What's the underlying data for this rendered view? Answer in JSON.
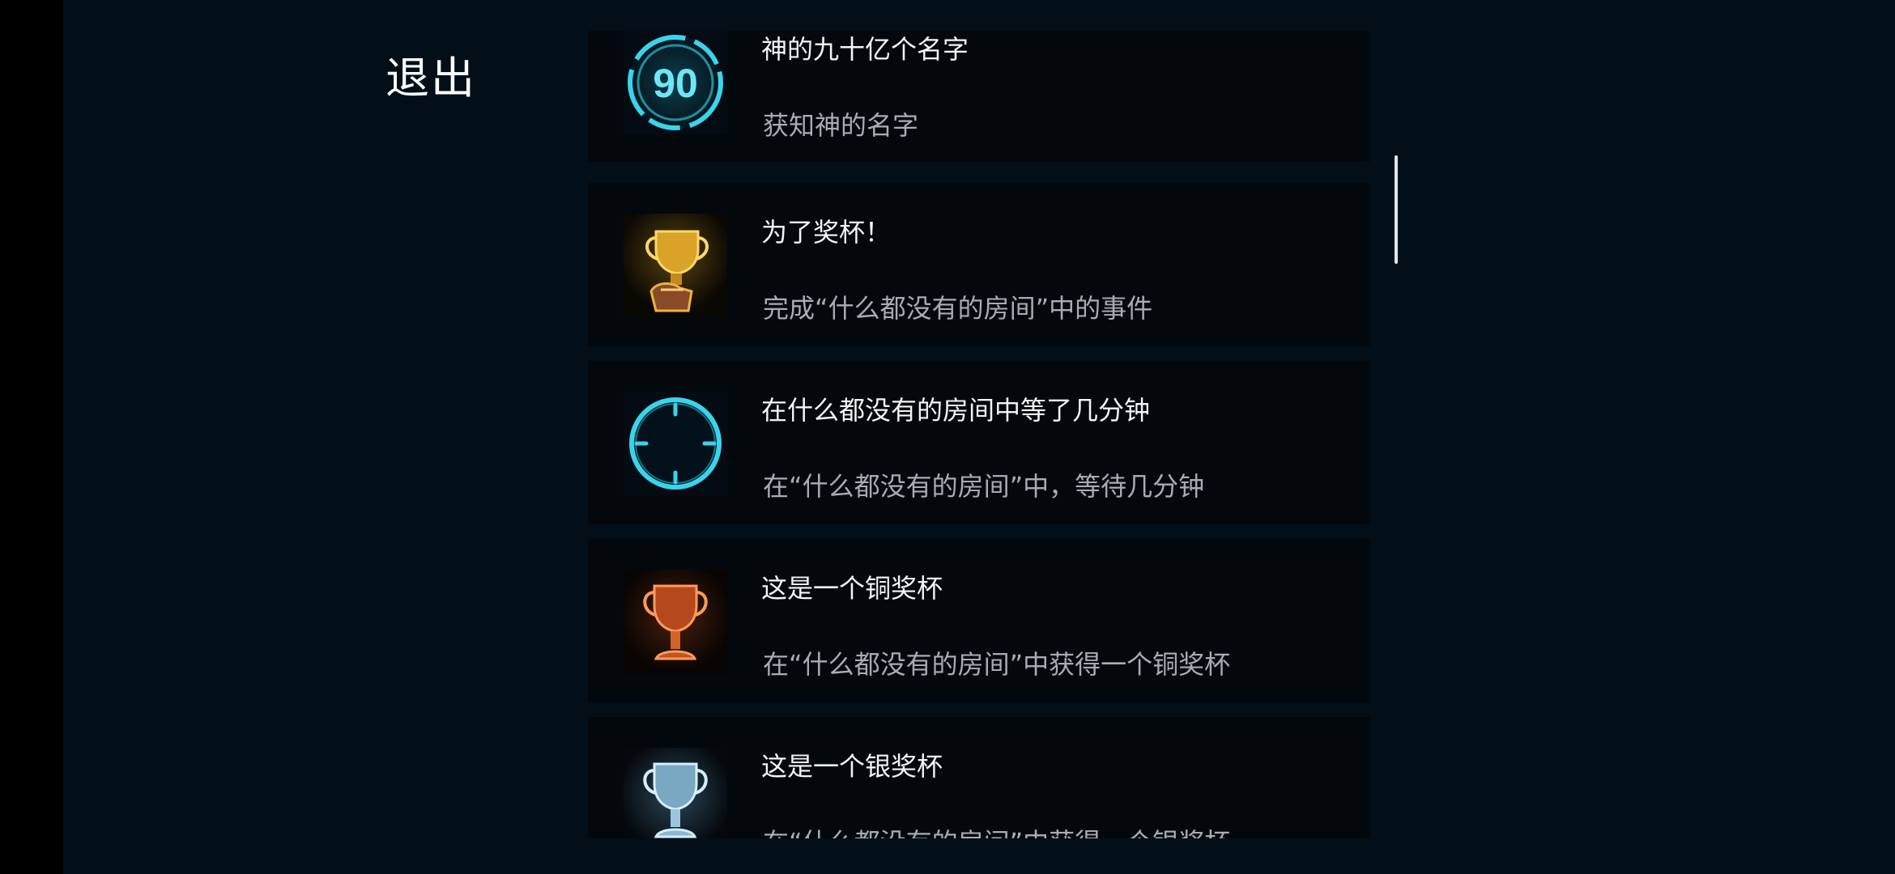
{
  "header": {
    "exit_label": "退出"
  },
  "achievements": [
    {
      "icon": "number-90-badge-icon",
      "icon_text": "90",
      "title": "神的九十亿个名字",
      "description": "获知神的名字"
    },
    {
      "icon": "gold-trophy-hand-icon",
      "title": "为了奖杯！",
      "description": "完成“什么都没有的房间”中的事件"
    },
    {
      "icon": "clock-icon",
      "title": "在什么都没有的房间中等了几分钟",
      "description": "在“什么都没有的房间”中，等待几分钟"
    },
    {
      "icon": "bronze-trophy-icon",
      "title": "这是一个铜奖杯",
      "description": "在“什么都没有的房间”中获得一个铜奖杯"
    },
    {
      "icon": "silver-trophy-icon",
      "title": "这是一个银奖杯",
      "description": "在“什么都没有的房间”中获得一个银奖杯"
    }
  ],
  "colors": {
    "background": "#020e18",
    "card": "#03080d",
    "cyan_icon": "#39d4ec",
    "gold_icon": "#e8b43a",
    "bronze_icon": "#f07a3a",
    "silver_icon": "#a9d6f0"
  }
}
